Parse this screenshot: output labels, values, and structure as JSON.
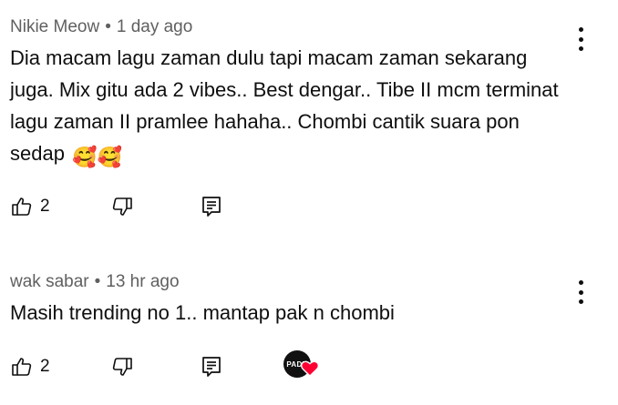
{
  "comments": [
    {
      "author": "Nikie Meow",
      "separator": "•",
      "time": "1 day ago",
      "text": "Dia macam lagu zaman dulu tapi macam zaman sekarang juga. Mix gitu ada 2 vibes.. Best dengar.. Tibe II mcm terminat lagu zaman II pramlee hahaha.. Chombi cantik suara pon sedap",
      "emojis": "🥰🥰",
      "likes": "2"
    },
    {
      "author": "wak sabar",
      "separator": "•",
      "time": "13 hr ago",
      "text": "Masih trending no 1.. mantap pak n chombi",
      "likes": "2",
      "creator_heart_badge": "PADU"
    }
  ],
  "icons": {
    "like": "thumbs-up-icon",
    "dislike": "thumbs-down-icon",
    "reply": "reply-icon",
    "menu": "more-vert-icon",
    "heart": "heart-icon"
  },
  "colors": {
    "text": "#0f0f0f",
    "meta": "#606060",
    "heart": "#ff0033"
  }
}
